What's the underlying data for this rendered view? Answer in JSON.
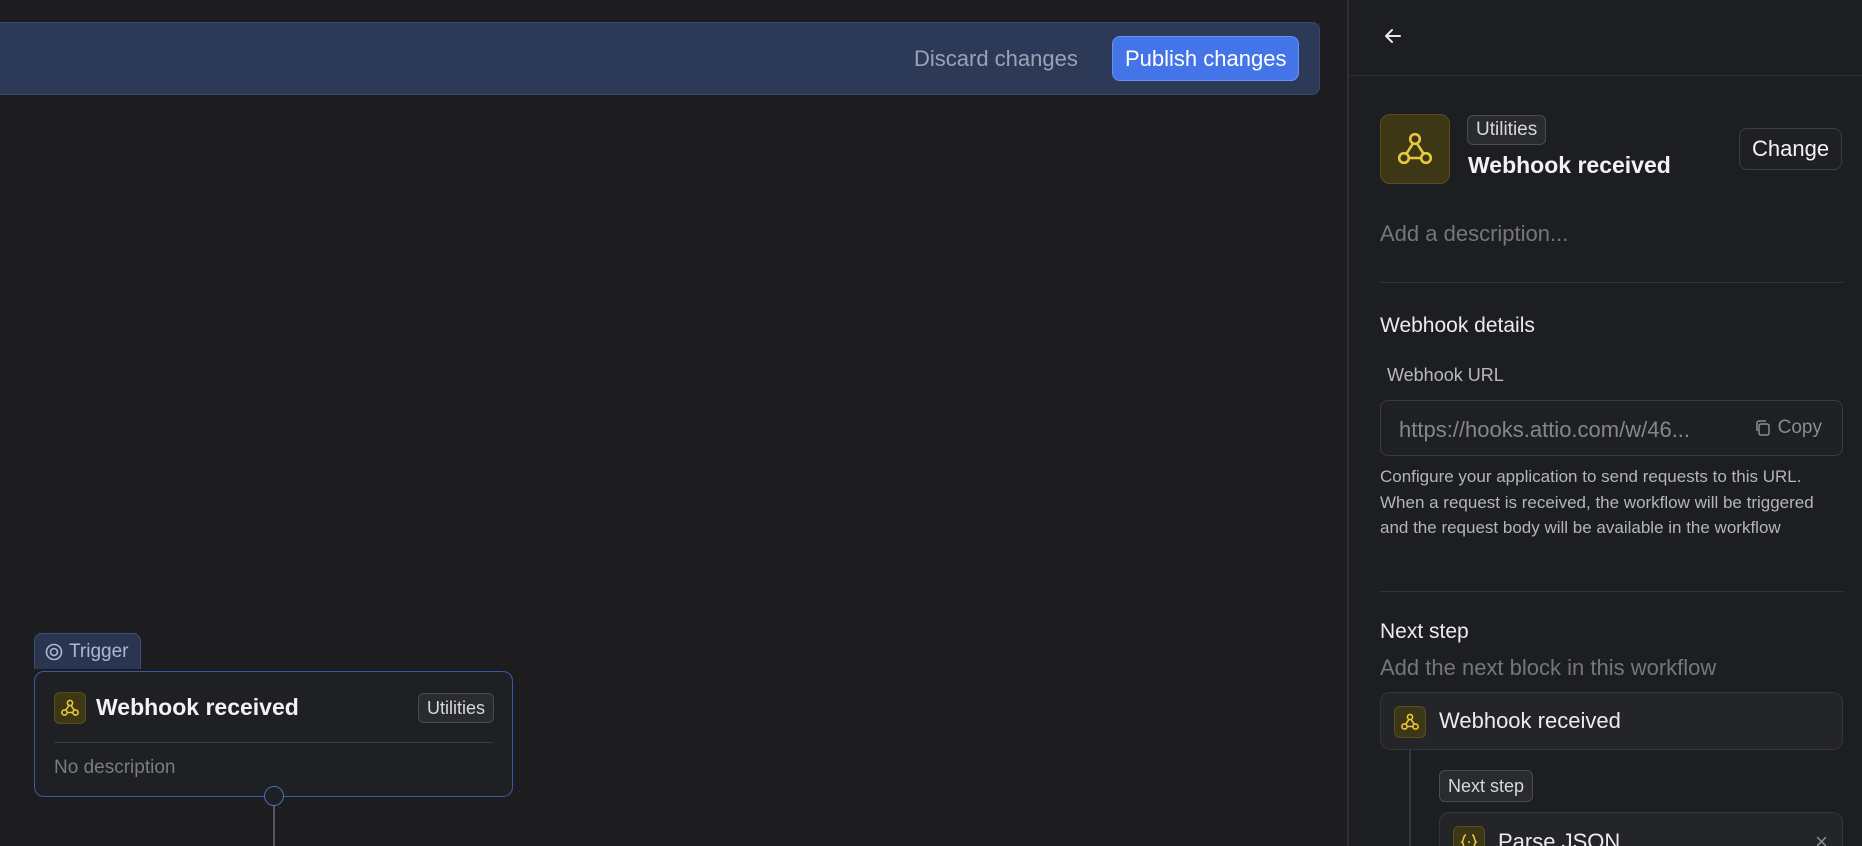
{
  "toolbar": {
    "discard_label": "Discard changes",
    "publish_label": "Publish changes"
  },
  "canvas": {
    "trigger_tab_label": "Trigger",
    "node": {
      "title": "Webhook received",
      "badge": "Utilities",
      "description": "No description"
    }
  },
  "panel": {
    "block": {
      "category": "Utilities",
      "title": "Webhook received",
      "change_label": "Change",
      "description_placeholder": "Add a description..."
    },
    "webhook_details": {
      "heading": "Webhook details",
      "url_label": "Webhook URL",
      "url_value": "https://hooks.attio.com/w/46...",
      "copy_label": "Copy",
      "help_text": "Configure your application to send requests to this URL. When a request is received, the workflow will be triggered and the request body will be available in the workflow"
    },
    "next_step": {
      "heading": "Next step",
      "subheading": "Add the next block in this workflow",
      "current_block": "Webhook received",
      "next_badge": "Next step",
      "next_block": "Parse JSON"
    }
  },
  "colors": {
    "accent": "#4475e8",
    "icon_yellow": "#e8c93a",
    "background": "#1c1c1f"
  }
}
